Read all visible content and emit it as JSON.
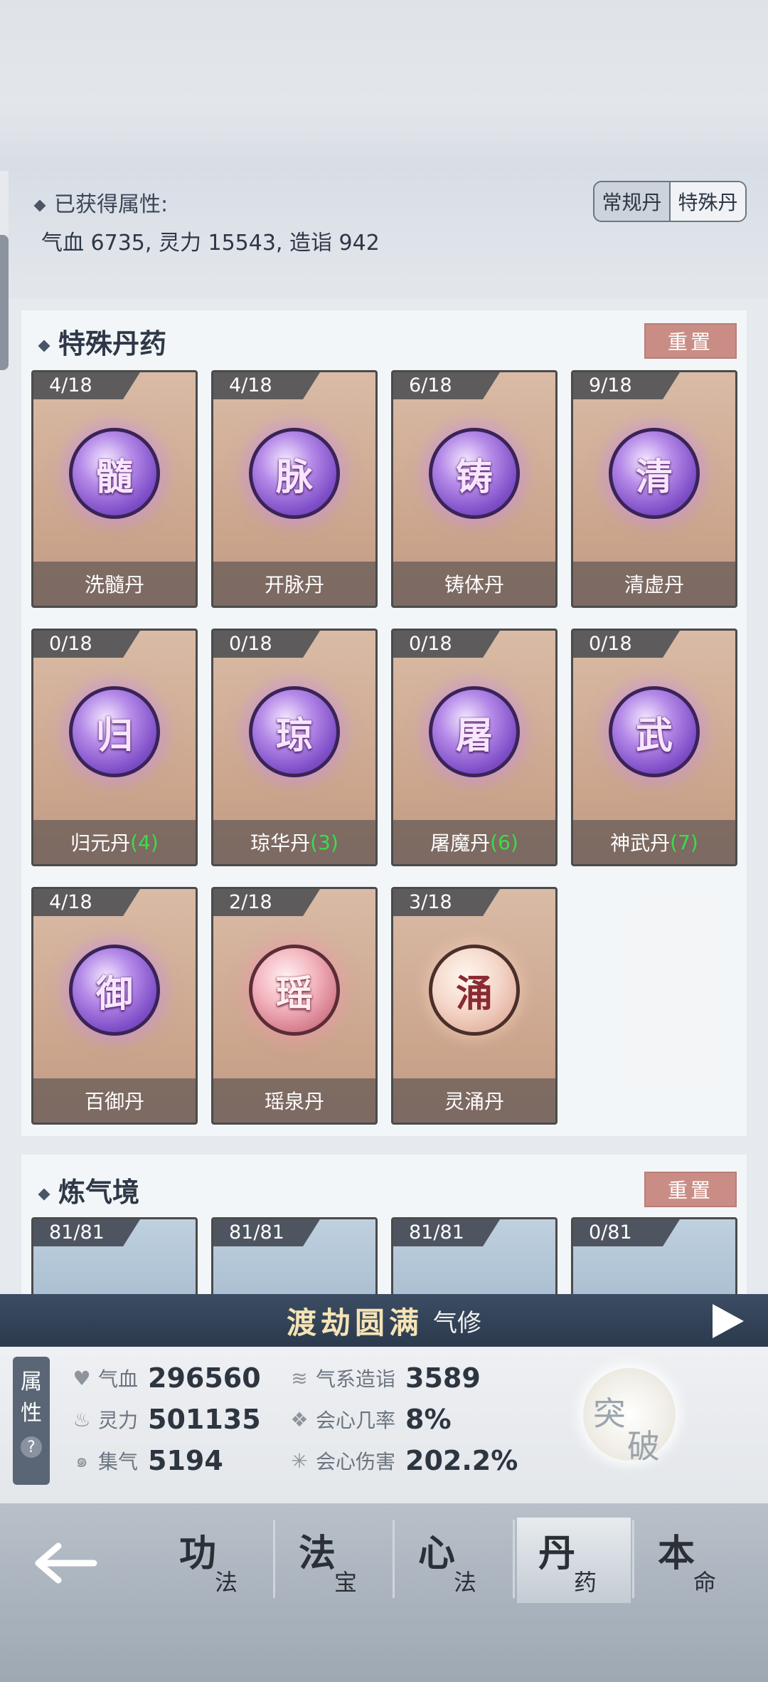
{
  "header": {
    "title": "已获得属性:",
    "summary": "气血 6735, 灵力 15543, 造诣 942",
    "toggle": [
      "常规丹",
      "特殊丹"
    ],
    "toggle_active": 1
  },
  "special": {
    "title": "特殊丹药",
    "reset_label": "重置",
    "cards": [
      {
        "count": "4/18",
        "glyph": "髓",
        "name": "洗髓丹",
        "extra": "",
        "style": "purple"
      },
      {
        "count": "4/18",
        "glyph": "脉",
        "name": "开脉丹",
        "extra": "",
        "style": "purple"
      },
      {
        "count": "6/18",
        "glyph": "铸",
        "name": "铸体丹",
        "extra": "",
        "style": "purple"
      },
      {
        "count": "9/18",
        "glyph": "清",
        "name": "清虚丹",
        "extra": "",
        "style": "purple"
      },
      {
        "count": "0/18",
        "glyph": "归",
        "name": "归元丹",
        "extra": "(4)",
        "style": "purple"
      },
      {
        "count": "0/18",
        "glyph": "琼",
        "name": "琼华丹",
        "extra": "(3)",
        "style": "purple"
      },
      {
        "count": "0/18",
        "glyph": "屠",
        "name": "屠魔丹",
        "extra": "(6)",
        "style": "purple"
      },
      {
        "count": "0/18",
        "glyph": "武",
        "name": "神武丹",
        "extra": "(7)",
        "style": "purple"
      },
      {
        "count": "4/18",
        "glyph": "御",
        "name": "百御丹",
        "extra": "",
        "style": "purple"
      },
      {
        "count": "2/18",
        "glyph": "瑶",
        "name": "瑶泉丹",
        "extra": "",
        "style": "pink"
      },
      {
        "count": "3/18",
        "glyph": "涌",
        "name": "灵涌丹",
        "extra": "",
        "style": "peach"
      }
    ]
  },
  "lianqi": {
    "title": "炼气境",
    "reset_label": "重置",
    "cards": [
      {
        "count": "81/81"
      },
      {
        "count": "81/81"
      },
      {
        "count": "81/81"
      },
      {
        "count": "0/81"
      }
    ]
  },
  "banner": {
    "title": "渡劫圆满",
    "subtitle": "气修"
  },
  "stats": {
    "tab_label_1": "属",
    "tab_label_2": "性",
    "help": "?",
    "items": [
      {
        "icon": "heart-icon",
        "label": "气血",
        "value": "296560"
      },
      {
        "icon": "flame-icon",
        "label": "灵力",
        "value": "501135"
      },
      {
        "icon": "swirl-icon",
        "label": "集气",
        "value": "5194"
      },
      {
        "icon": "wind-icon",
        "label": "气系造诣",
        "value": "3589"
      },
      {
        "icon": "crit-rate-icon",
        "label": "会心几率",
        "value": "8%"
      },
      {
        "icon": "crit-damage-icon",
        "label": "会心伤害",
        "value": "202.2%"
      }
    ],
    "breakthrough_1": "突",
    "breakthrough_2": "破"
  },
  "nav": {
    "items": [
      {
        "c1": "功",
        "c2": "法"
      },
      {
        "c1": "法",
        "c2": "宝"
      },
      {
        "c1": "心",
        "c2": "法"
      },
      {
        "c1": "丹",
        "c2": "药"
      },
      {
        "c1": "本",
        "c2": "命"
      }
    ],
    "active_index": 3
  }
}
